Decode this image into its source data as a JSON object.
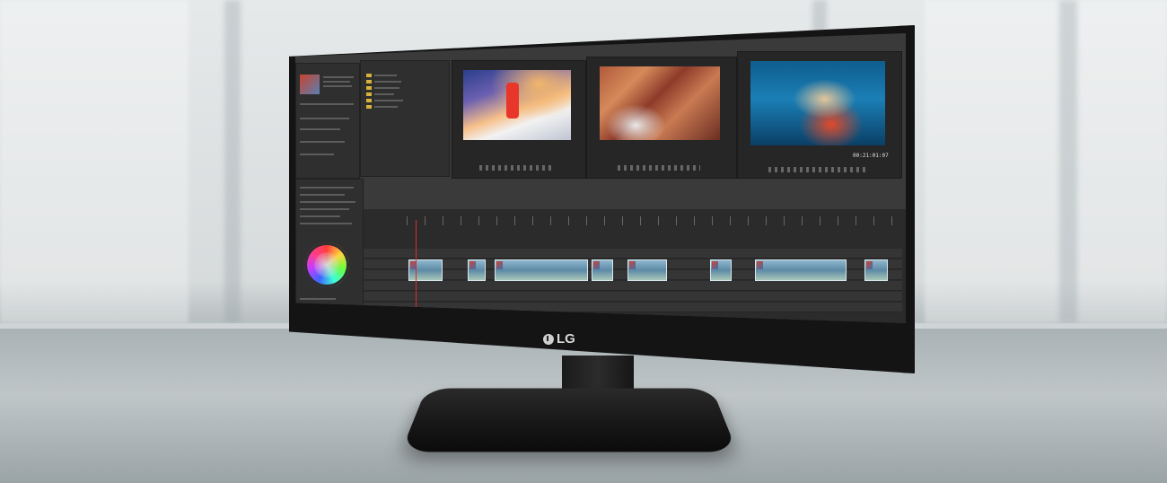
{
  "scene": {
    "description_type": "product photo",
    "brand_logo_text": "LG"
  },
  "colors": {
    "accent_timecode": "#e8b33a",
    "playhead": "#e02a2a"
  },
  "editor": {
    "program_timecode": "",
    "monitors": [
      {
        "name": "monitor-1",
        "left_timecode": "",
        "right_timecode": ""
      },
      {
        "name": "monitor-2",
        "left_timecode": "",
        "right_timecode": ""
      },
      {
        "name": "monitor-3",
        "left_timecode": "",
        "right_timecode": "00:21:01:07"
      }
    ]
  }
}
